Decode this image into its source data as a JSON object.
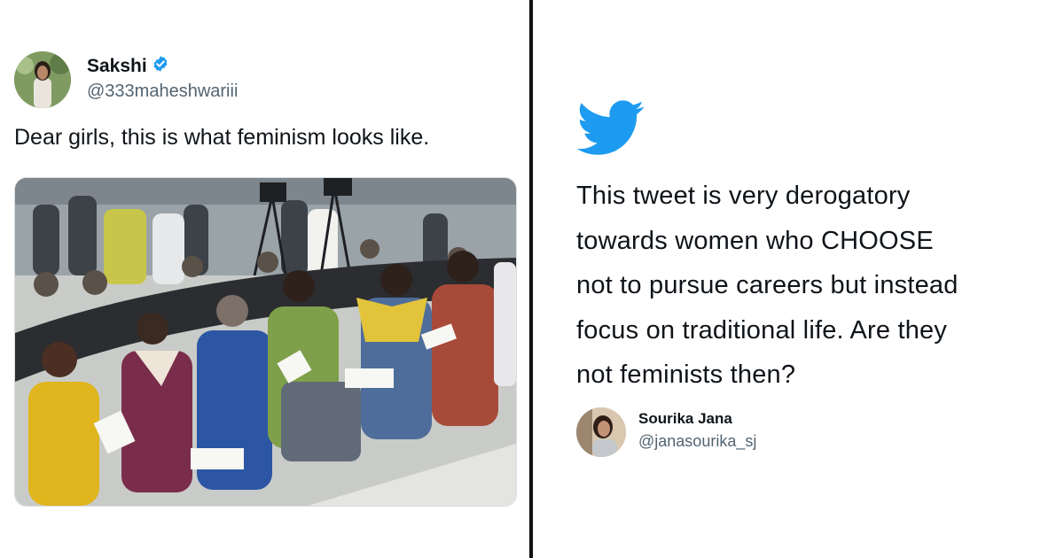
{
  "left_tweet": {
    "author_name": "Sakshi",
    "author_handle": "@333maheshwariii",
    "verified_icon": "verified-badge-icon",
    "text": "Dear girls, this is what feminism looks like.",
    "media": "photo"
  },
  "right_tweet": {
    "platform_icon": "twitter-bird-icon",
    "brand_color": "#1d9bf0",
    "lines": [
      "This tweet is very derogatory",
      "towards women who CHOOSE",
      "not to pursue careers but instead",
      "focus on traditional life. Are they",
      "not feminists then?"
    ],
    "author_name": "Sourika Jana",
    "author_handle": "@janasourika_sj"
  },
  "colors": {
    "text": "#0f1419",
    "secondary_text": "#536471",
    "divider": "#111111",
    "verified": "#1d9bf0"
  }
}
